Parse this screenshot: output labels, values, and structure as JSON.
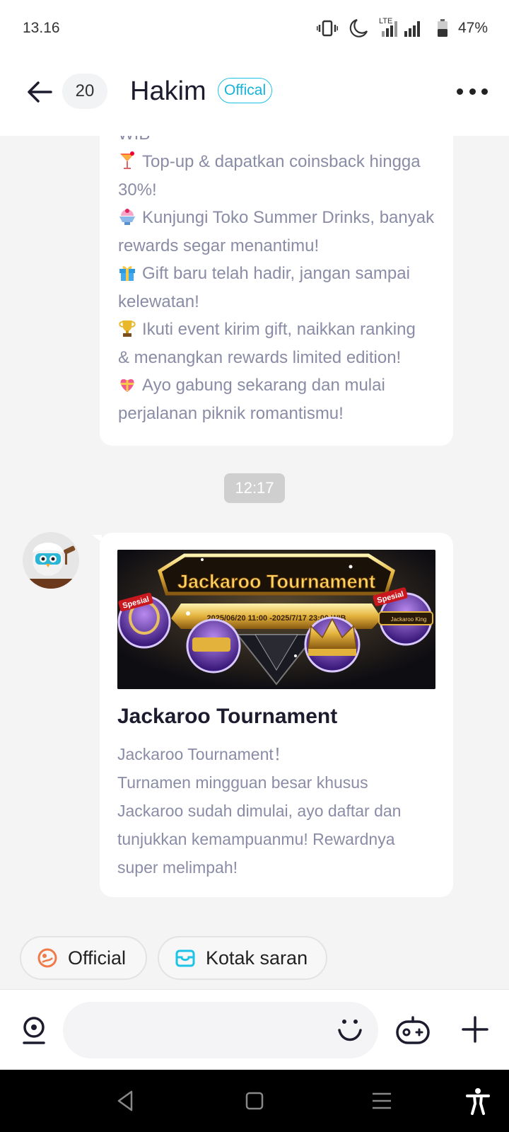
{
  "status_bar": {
    "time": "13.16",
    "network_label": "LTE",
    "battery": "47%"
  },
  "header": {
    "back_icon": "arrow-left-icon",
    "unread_count": "20",
    "title": "Hakim",
    "badge": "Offical",
    "more_icon": "more-horizontal-icon"
  },
  "messages": [
    {
      "partial_top_text": "WIB",
      "lines": [
        {
          "emoji": "cocktail-icon",
          "text": "Top-up & dapatkan coinsback hingga"
        },
        {
          "text": "30%!"
        },
        {
          "emoji": "shaved-ice-icon",
          "text": "Kunjungi Toko Summer Drinks, banyak"
        },
        {
          "text": "rewards segar menantimu!"
        },
        {
          "emoji": "gift-icon",
          "text": "Gift baru telah hadir, jangan sampai"
        },
        {
          "text": "kelewatan!"
        },
        {
          "emoji": "trophy-icon",
          "text": "Ikuti event kirim gift, naikkan ranking"
        },
        {
          "text": "& menangkan rewards limited edition!"
        },
        {
          "emoji": "heart-ribbon-icon",
          "text": "Ayo gabung sekarang dan mulai"
        },
        {
          "text": "perjalanan piknik romantismu!"
        }
      ]
    }
  ],
  "timestamp": "12:17",
  "card": {
    "banner": {
      "title": "Jackaroo Tournament",
      "date_range": "2025/06/20 11:00 -2025/7/17 23:00 WIB",
      "tag_left": "Spesial",
      "tag_right": "Spesial",
      "name_tag": "Jackaroo King"
    },
    "title": "Jackaroo Tournament",
    "body_lines": [
      "Jackaroo Tournament！",
      "Turnamen mingguan besar khusus",
      "Jackaroo sudah dimulai, ayo daftar dan",
      "tunjukkan kemampuanmu! Rewardnya",
      "super melimpah!"
    ]
  },
  "quick_actions": [
    {
      "label": "Official",
      "icon": "planet-icon",
      "color": "#f07a4a"
    },
    {
      "label": "Kotak saran",
      "icon": "inbox-icon",
      "color": "#1ec3e6"
    }
  ],
  "input_bar": {
    "placeholder": "",
    "voice_icon": "microphone-icon",
    "emoji_icon": "smile-icon",
    "game_icon": "gamepad-icon",
    "plus_icon": "plus-icon"
  },
  "nav_bar": {
    "back_icon": "nav-back-icon",
    "home_icon": "nav-home-icon",
    "recents_icon": "nav-menu-icon",
    "accessibility_icon": "accessibility-icon"
  }
}
